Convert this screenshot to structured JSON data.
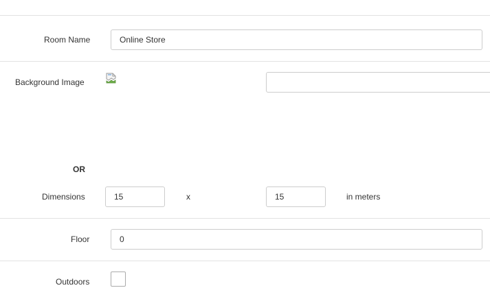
{
  "room_name": {
    "label": "Room Name",
    "value": "Online Store"
  },
  "background_image": {
    "label": "Background Image",
    "url_value": "",
    "image_icon": "broken-image-icon"
  },
  "or_label": "OR",
  "dimensions": {
    "label": "Dimensions",
    "width_value": "15",
    "separator": "x",
    "height_value": "15",
    "unit": "in meters"
  },
  "floor": {
    "label": "Floor",
    "value": "0"
  },
  "outdoors": {
    "label": "Outdoors",
    "checked": false
  }
}
